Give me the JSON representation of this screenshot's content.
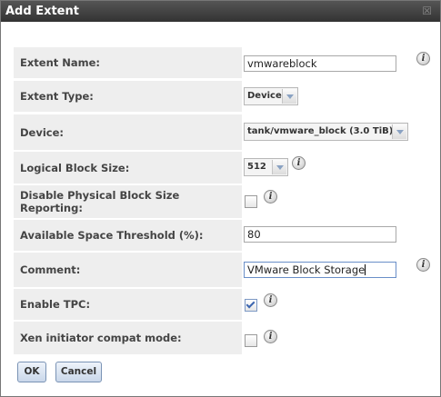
{
  "dialog": {
    "title": "Add Extent",
    "close_glyph": "☒"
  },
  "form": {
    "extent_name": {
      "label": "Extent Name:",
      "value": "vmwareblock"
    },
    "extent_type": {
      "label": "Extent Type:",
      "value": "Device"
    },
    "device": {
      "label": "Device:",
      "value": "tank/vmware_block (3.0 TiB)"
    },
    "logical_block_size": {
      "label": "Logical Block Size:",
      "value": "512"
    },
    "disable_pbs": {
      "label": "Disable Physical Block Size Reporting:",
      "checked": false
    },
    "avail_threshold": {
      "label": "Available Space Threshold (%):",
      "value": "80"
    },
    "comment": {
      "label": "Comment:",
      "value": "VMware Block Storage"
    },
    "enable_tpc": {
      "label": "Enable TPC:",
      "checked": true
    },
    "xen_compat": {
      "label": "Xen initiator compat mode:",
      "checked": false
    }
  },
  "info_glyph": "i",
  "buttons": {
    "ok": "OK",
    "cancel": "Cancel"
  }
}
